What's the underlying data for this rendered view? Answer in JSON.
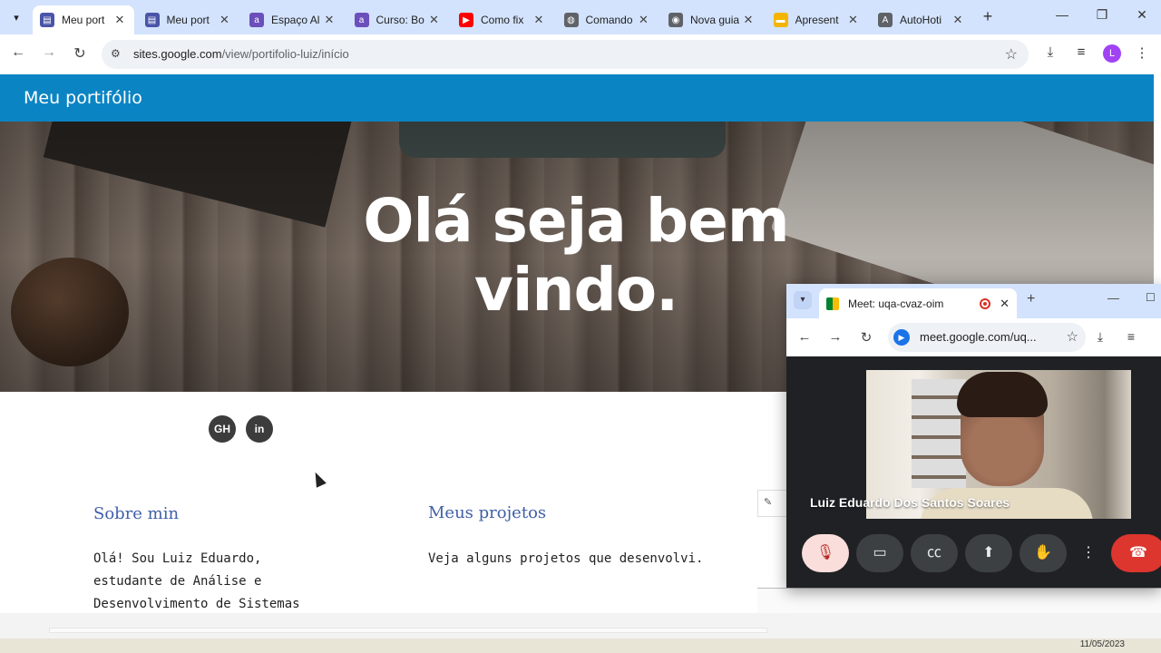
{
  "browser": {
    "tabs": [
      {
        "title": "Meu port",
        "favicon": "sites-icon",
        "color": "#4a55a8",
        "active": true
      },
      {
        "title": "Meu port",
        "favicon": "sites-icon",
        "color": "#4a55a8",
        "active": false
      },
      {
        "title": "Espaço Al",
        "favicon": "alura-icon",
        "color": "#6b4fbb",
        "active": false
      },
      {
        "title": "Curso: Bo",
        "favicon": "alura-icon",
        "color": "#6b4fbb",
        "active": false
      },
      {
        "title": "Como fix",
        "favicon": "youtube-icon",
        "color": "#ff0000",
        "active": false
      },
      {
        "title": "Comando",
        "favicon": "globe-icon",
        "color": "#5f6368",
        "active": false
      },
      {
        "title": "Nova guia",
        "favicon": "chrome-icon",
        "color": "#5f6368",
        "active": false
      },
      {
        "title": "Apresent",
        "favicon": "slides-icon",
        "color": "#f4b400",
        "active": false
      },
      {
        "title": "AutoHoti",
        "favicon": "autohotkey-icon",
        "color": "#5f6368",
        "active": false
      }
    ],
    "url_host": "sites.google.com",
    "url_path": "/view/portifolio-luiz/início",
    "profile_initial": "L"
  },
  "site": {
    "brand": "Meu portifólio",
    "headline": "Olá seja bem vindo.",
    "social": {
      "github": "GH",
      "linkedin": "in"
    },
    "about_title": "Sobre min",
    "about_text": "Olá! Sou Luiz Eduardo, estudante de Análise e Desenvolvimento de Sistemas com foco em back-end.",
    "projects_title": "Meus projetos",
    "projects_text": "Veja alguns projetos que desenvolvi."
  },
  "meet": {
    "tab_title": "Meet: uqa-cvaz-oim",
    "url": "meet.google.com/uq...",
    "participant_name": "Luiz Eduardo Dos Santos Soares",
    "controls": [
      "mic-off",
      "camera",
      "captions",
      "present",
      "raise-hand",
      "more",
      "leave-call"
    ]
  },
  "taskbar": {
    "date": "11/05/2023"
  },
  "colors": {
    "header": "#0b84c4",
    "section_title": "#3f5fa8",
    "tab_strip": "#d3e3fd"
  }
}
